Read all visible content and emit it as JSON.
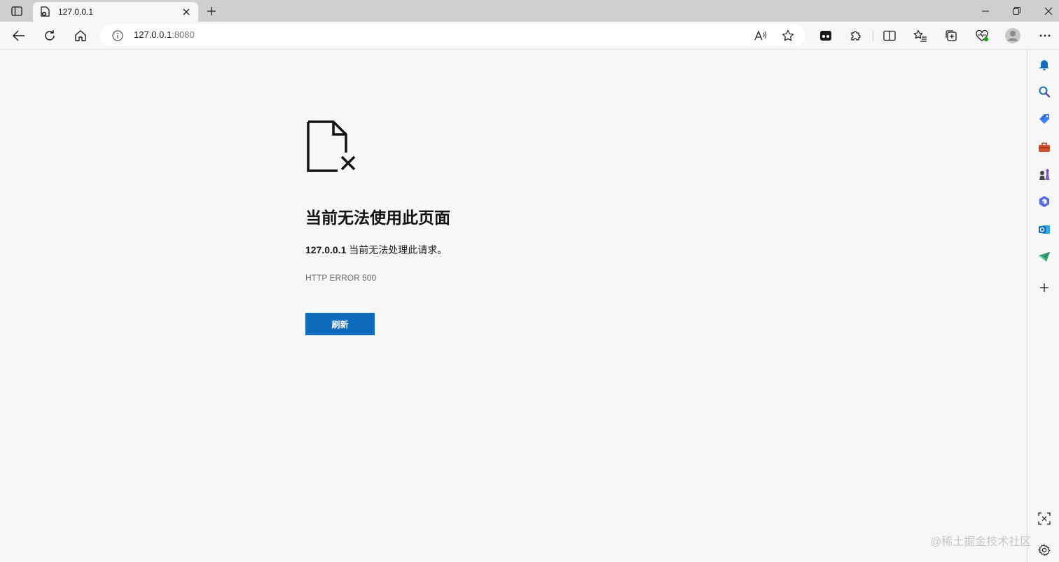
{
  "tab": {
    "title": "127.0.0.1"
  },
  "address_bar": {
    "host": "127.0.0.1",
    "port": ":8080"
  },
  "error": {
    "title": "当前无法使用此页面",
    "host": "127.0.0.1",
    "message": " 当前无法处理此请求。",
    "code": "HTTP ERROR 500",
    "reload_label": "刷新"
  },
  "watermark": "@稀土掘金技术社区",
  "colors": {
    "accent": "#0f6cbd",
    "background": "#f7f7f7",
    "tabstrip": "#cfcfcf"
  }
}
